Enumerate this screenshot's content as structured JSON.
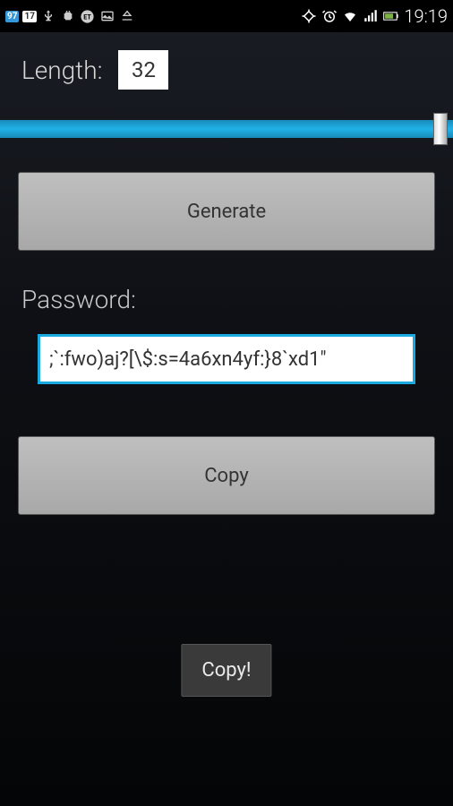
{
  "statusBar": {
    "badge1": "97",
    "badge2": "17",
    "time": "19:19"
  },
  "length": {
    "label": "Length:",
    "value": "32"
  },
  "generateButton": "Generate",
  "password": {
    "label": "Password:",
    "value": ";`:fwo)aj?[\\$:s=4a6xn4yf:}8`xd1\""
  },
  "copyButton": "Copy",
  "toast": "Copy!"
}
